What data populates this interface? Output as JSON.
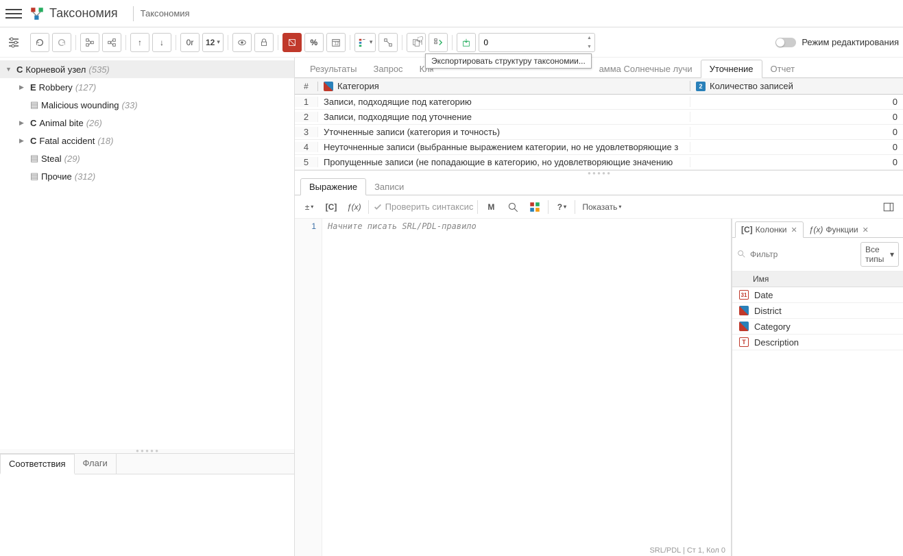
{
  "header": {
    "title": "Таксономия",
    "subtitle": "Таксономия"
  },
  "toolbar": {
    "or_label": "0r",
    "size_label": "12",
    "spinner_value": "0",
    "edit_mode_label": "Режим редактирования",
    "tooltip": "Экспортировать структуру таксономии..."
  },
  "tree": {
    "root": {
      "type": "C",
      "label": "Корневой узел",
      "count": "(535)"
    },
    "children": [
      {
        "arrow": true,
        "type": "E",
        "label": "Robbery",
        "count": "(127)"
      },
      {
        "arrow": false,
        "doc": true,
        "label": "Malicious wounding",
        "count": "(33)"
      },
      {
        "arrow": true,
        "type": "C",
        "label": "Animal bite",
        "count": "(26)"
      },
      {
        "arrow": true,
        "type": "C",
        "label": "Fatal accident",
        "count": "(18)"
      },
      {
        "arrow": false,
        "doc": true,
        "label": "Steal",
        "count": "(29)"
      },
      {
        "arrow": false,
        "doc": true,
        "label": "Прочие",
        "count": "(312)"
      }
    ]
  },
  "left_bottom_tabs": [
    "Соответствия",
    "Флаги"
  ],
  "right_tabs": [
    "Результаты",
    "Запрос",
    "Клю",
    "амма Солнечные лучи",
    "Уточнение",
    "Отчет"
  ],
  "right_tabs_active": 4,
  "grid": {
    "header_num": "#",
    "header_cat": "Категория",
    "header_count": "Количество записей",
    "rows": [
      {
        "n": "1",
        "cat": "Записи, подходящие под категорию",
        "count": "0"
      },
      {
        "n": "2",
        "cat": "Записи, подходящие под уточнение",
        "count": "0"
      },
      {
        "n": "3",
        "cat": "Уточненные записи (категория и точность)",
        "count": "0"
      },
      {
        "n": "4",
        "cat": "Неуточненные записи (выбранные выражением категории, но не удовлетворяющие з",
        "count": "0"
      },
      {
        "n": "5",
        "cat": "Пропущенные записи (не попадающие в категорию, но удовлетворяющие значению",
        "count": "0"
      }
    ]
  },
  "expr": {
    "tabs": [
      "Выражение",
      "Записи"
    ],
    "check_syntax": "Проверить синтаксис",
    "show_label": "Показать",
    "m_label": "M",
    "q_label": "?",
    "c_label": "[C]",
    "fx_label": "ƒ(x)",
    "line_num": "1",
    "placeholder": "Начните писать SRL/PDL-правило",
    "status": "SRL/PDL | Ст 1, Кол 0"
  },
  "side": {
    "tab1_icon": "[C]",
    "tab1_label": "Колонки",
    "tab2_icon": "ƒ(x)",
    "tab2_label": "Функции",
    "filter_placeholder": "Фильтр",
    "type_dd": "Все типы",
    "header": "Имя",
    "cols": [
      {
        "icon": "date",
        "label": "Date"
      },
      {
        "icon": "cat",
        "label": "District"
      },
      {
        "icon": "cat",
        "label": "Category"
      },
      {
        "icon": "text",
        "label": "Description"
      }
    ]
  }
}
